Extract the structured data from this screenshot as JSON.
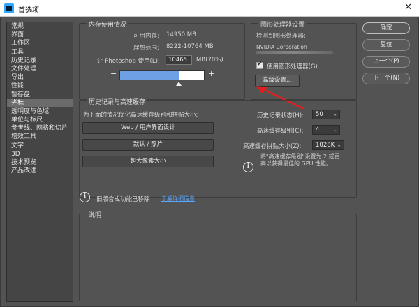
{
  "window": {
    "title": "首选项"
  },
  "sidebar": {
    "active_index": 9,
    "items": [
      "常规",
      "界面",
      "工作区",
      "工具",
      "历史记录",
      "文件处理",
      "导出",
      "性能",
      "暂存盘",
      "光标",
      "透明度与色域",
      "单位与标尺",
      "参考线、网格和切片",
      "增效工具",
      "文字",
      "3D",
      "技术预览",
      "产品改进"
    ]
  },
  "memory": {
    "legend": "内存使用情况",
    "available_label": "可用内存:",
    "available_value": "14950 MB",
    "ideal_label": "理想范围:",
    "ideal_value": "8222-10764 MB",
    "let_label": "让 Photoshop 使用(L):",
    "value": "10465",
    "unit_pct": "MB(70%)",
    "minus": "−",
    "plus": "+",
    "fill_fraction": 0.7
  },
  "gpu": {
    "legend": "图形处理器设置",
    "detected_label": "检测到图形处理器:",
    "vendor": "NVIDIA Corporation",
    "use_gpu_label": "使用图形处理器(G)",
    "use_gpu_checked": true,
    "advanced_btn": "高级设置..."
  },
  "buttons": {
    "ok": "确定",
    "reset": "复位",
    "prev": "上一个(P)",
    "next": "下一个(N)"
  },
  "history": {
    "legend": "历史记录与高速缓存",
    "optimize_label": "为下面的情况优化高速缓存级别和拼贴大小:",
    "opt1": "Web / 用户界面设计",
    "opt2": "默认 / 照片",
    "opt3": "超大像素大小",
    "states_label": "历史记录状态(H):",
    "states_value": "50",
    "levels_label": "高速缓存级别(C):",
    "levels_value": "4",
    "tile_label": "高速缓存拼贴大小(Z):",
    "tile_value": "1028K",
    "note_line1": "将\"高速缓存级别\"设置为 2 或更",
    "note_line2": "高以获得最佳的 GPU 性能。"
  },
  "legacy": {
    "text": "旧版合成功能已移除",
    "link": "了解详细信息"
  },
  "description": {
    "legend": "说明"
  },
  "icons": {
    "info": "info-icon",
    "chevron": "chevron-down-icon",
    "close": "close-icon",
    "arrow": "red-arrow-annotation"
  },
  "colors": {
    "accent_blue": "#6ea0e6",
    "arrow_red": "#e02020",
    "link_blue": "#5aa8ff"
  }
}
